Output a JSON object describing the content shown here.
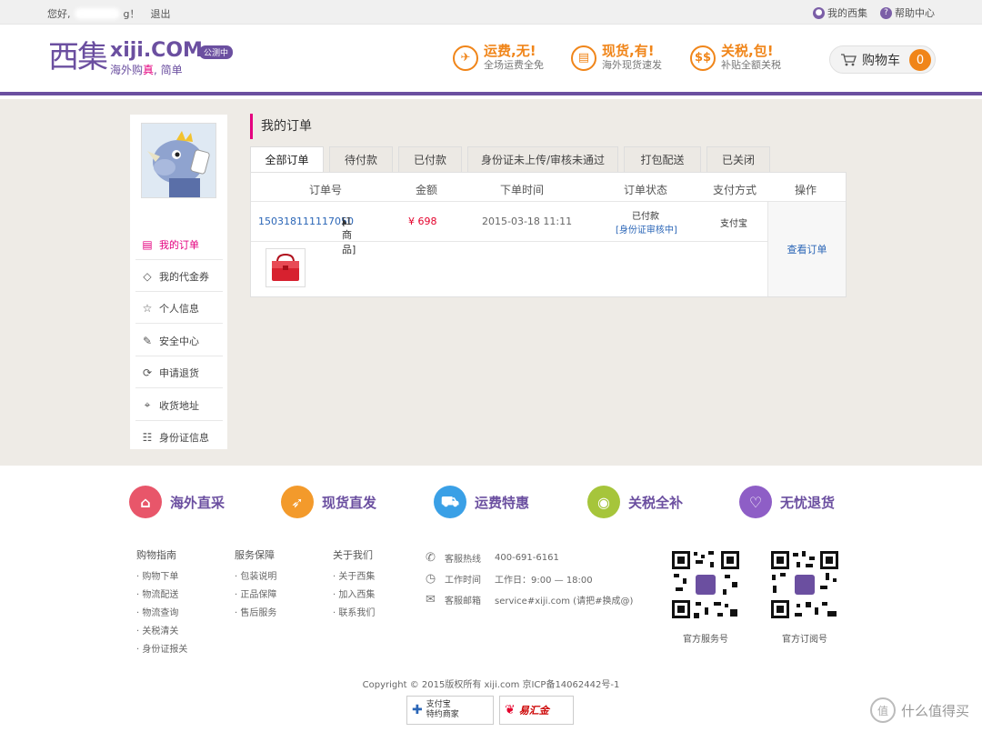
{
  "topbar": {
    "greeting": "您好,",
    "greeting_end": "g！",
    "logout": "退出",
    "my_xiji": "我的西集",
    "help": "帮助中心"
  },
  "header": {
    "logo_cn": "西集",
    "logo_en": "xiji.COM",
    "slogan_pre": "海外购",
    "slogan_mid": "真",
    "slogan_post": ", 简单",
    "beta": "公测中",
    "promos": [
      {
        "title": "运费,无!",
        "sub": "全场运费全免"
      },
      {
        "title": "现货,有!",
        "sub": "海外现货速发"
      },
      {
        "title": "关税,包!",
        "sub": "补贴全额关税"
      }
    ],
    "cart_label": "购物车",
    "cart_count": "0"
  },
  "sidebar": {
    "items": [
      {
        "label": "我的订单"
      },
      {
        "label": "我的代金券"
      },
      {
        "label": "个人信息"
      },
      {
        "label": "安全中心"
      },
      {
        "label": "申请退货"
      },
      {
        "label": "收货地址"
      },
      {
        "label": "身份证信息"
      }
    ]
  },
  "orders": {
    "title": "我的订单",
    "tabs": [
      "全部订单",
      "待付款",
      "已付款",
      "身份证未上传/审核未通过",
      "打包配送",
      "已关闭"
    ],
    "columns": [
      "订单号",
      "金额",
      "下单时间",
      "订单状态",
      "支付方式",
      "操作"
    ],
    "row": {
      "order_no": "150318111117050",
      "items": "[1商品]",
      "amount": "¥ 698",
      "time": "2015-03-18 11:11",
      "status": "已付款",
      "status_sub": "[身份证审核中]",
      "payment": "支付宝",
      "action": "查看订单"
    }
  },
  "footer": {
    "features": [
      {
        "label": "海外直采",
        "color": "#e8566a"
      },
      {
        "label": "现货直发",
        "color": "#f39a2b"
      },
      {
        "label": "运费特惠",
        "color": "#3aa0e6"
      },
      {
        "label": "关税全补",
        "color": "#a6c53b"
      },
      {
        "label": "无忧退货",
        "color": "#8e5ec6"
      }
    ],
    "guide": {
      "title": "购物指南",
      "links": [
        "购物下单",
        "物流配送",
        "物流查询",
        "关税清关",
        "身份证报关"
      ]
    },
    "service": {
      "title": "服务保障",
      "links": [
        "包装说明",
        "正品保障",
        "售后服务"
      ]
    },
    "about": {
      "title": "关于我们",
      "links": [
        "关于西集",
        "加入西集",
        "联系我们"
      ]
    },
    "contact": {
      "hotline_label": "客服热线",
      "hotline": "400-691-6161",
      "hours_label": "工作时间",
      "hours": "工作日：9:00 — 18:00",
      "email_label": "客服邮箱",
      "email": "service#xiji.com (请把#换成@)"
    },
    "qr1": "官方服务号",
    "qr2": "官方订阅号",
    "copyright": "Copyright © 2015版权所有 xiji.com 京ICP备14062442号-1",
    "badge1_a": "支付宝",
    "badge1_b": "特约商家",
    "badge2": "易汇金",
    "watermark": "什么值得买",
    "watermark_icon": "值"
  }
}
